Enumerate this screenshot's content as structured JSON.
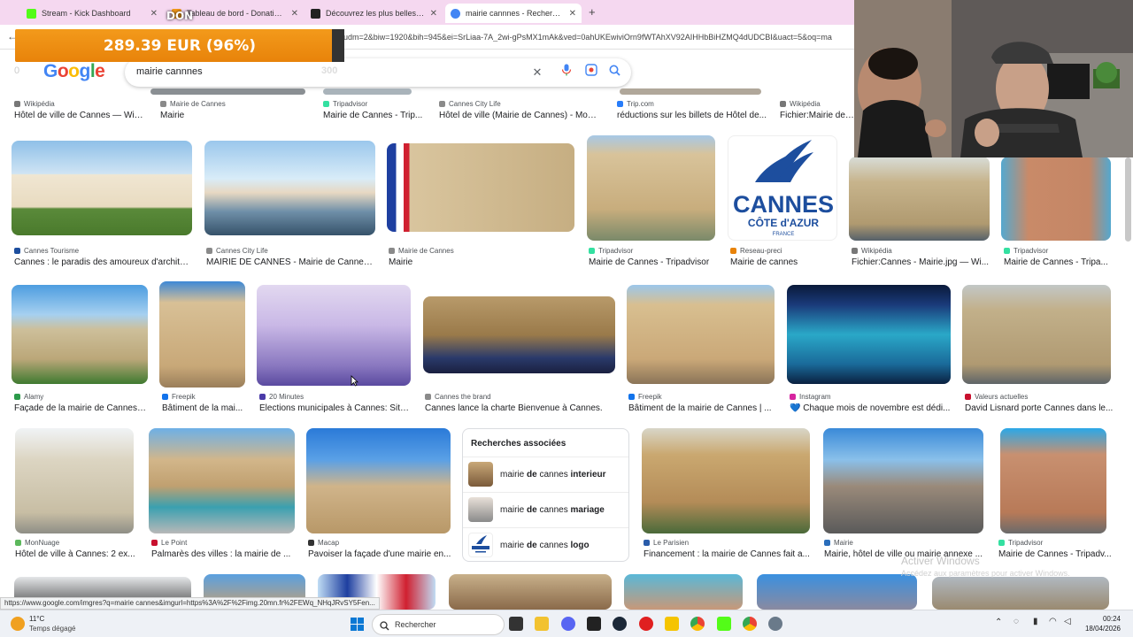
{
  "browser": {
    "tabs": [
      {
        "label": "Stream - Kick Dashboard",
        "color": "#53fc18"
      },
      {
        "label": "Tableau de bord - DonationAle",
        "color": "#f39a1b"
      },
      {
        "label": "Découvrez les plus belles mairi",
        "color": "#222222"
      },
      {
        "label": "mairie cannnes - Recherche Go",
        "color": "#4285f4"
      }
    ],
    "new_tab": "+",
    "url": "udm=2&biw=1920&bih=945&ei=SrLiaa-7A_2wi-gPsMX1mAk&ved=0ahUKEwiviOrn9fWTAhXV92AIHHbBiHZMQ4dUDCBI&uact=5&oq=ma"
  },
  "donation": {
    "amount": "289.39 EUR (96%)",
    "label": "DON"
  },
  "google": {
    "logo": "Google",
    "query": "mairie cannnes",
    "overlay_number": "300",
    "overlay_zero": "0"
  },
  "results": {
    "row0": [
      {
        "source": "Wikipédia",
        "caption": "Hôtel de ville de Cannes — Wiki...",
        "color": "#777777"
      },
      {
        "source": "Mairie de Cannes",
        "caption": "Mairie",
        "color": "#8a8a8a"
      },
      {
        "source": "Tripadvisor",
        "caption": "Mairie de Cannes - Trip...",
        "color": "#34e0a1"
      },
      {
        "source": "Cannes City Life",
        "caption": "Hôtel de ville (Mairie de Cannes) - Mon...",
        "color": "#8a8a8a"
      },
      {
        "source": "Trip.com",
        "caption": "réductions sur les billets de Hôtel de...",
        "color": "#287dfa"
      },
      {
        "source": "Wikipédia",
        "caption": "Fichier:Mairie de Ca",
        "color": "#777777"
      }
    ],
    "row1": [
      {
        "source": "Cannes Tourisme",
        "caption": "Cannes : le paradis des amoureux d'archite...",
        "color": "#1d4e9e"
      },
      {
        "source": "Cannes City Life",
        "caption": "MAIRIE DE CANNES - Mairie de Cannes ...",
        "color": "#8a8a8a"
      },
      {
        "source": "Mairie de Cannes",
        "caption": "Mairie",
        "color": "#8a8a8a"
      },
      {
        "source": "Tripadvisor",
        "caption": "Mairie de Cannes - Tripadvisor",
        "color": "#34e0a1"
      },
      {
        "source": "Reseau-preci",
        "caption": "Mairie de cannes",
        "color": "#e8830a"
      },
      {
        "source": "Wikipédia",
        "caption": "Fichier:Cannes - Mairie.jpg — Wi...",
        "color": "#777777"
      },
      {
        "source": "Tripadvisor",
        "caption": "Mairie de Cannes - Tripa...",
        "color": "#34e0a1"
      }
    ],
    "cannes_logo": {
      "word": "CANNES",
      "line2": "CÔTE d'AZUR",
      "line3": "FRANCE"
    },
    "row2": [
      {
        "source": "Alamy",
        "caption": "Façade de la mairie de Cannes,...",
        "color": "#2b9a4a"
      },
      {
        "source": "Freepik",
        "caption": "Bâtiment de la mai...",
        "color": "#1273eb"
      },
      {
        "source": "20 Minutes",
        "caption": "Élections municipales à Cannes: Situ...",
        "color": "#4a3aa8"
      },
      {
        "source": "Cannes the brand",
        "caption": "Cannes lance la charte Bienvenue à Cannes.",
        "color": "#8a8a8a"
      },
      {
        "source": "Freepik",
        "caption": "Bâtiment de la mairie de Cannes | ...",
        "color": "#1273eb"
      },
      {
        "source": "Instagram",
        "caption": "💙 Chaque mois de novembre est dédi...",
        "color": "#d6249f"
      },
      {
        "source": "Valeurs actuelles",
        "caption": "David Lisnard porte Cannes dans le...",
        "color": "#c8102e"
      }
    ],
    "row3": [
      {
        "source": "MonNuage",
        "caption": "Hôtel de ville à Cannes: 2 ex...",
        "color": "#5cb85c"
      },
      {
        "source": "Le Point",
        "caption": "Palmarès des villes : la mairie de ...",
        "color": "#c8102e"
      },
      {
        "source": "Macap",
        "caption": "Pavoiser la façade d'une mairie en...",
        "color": "#333333"
      },
      {
        "source": "Le Parisien",
        "caption": "Financement : la mairie de Cannes fait a...",
        "color": "#2a5caa"
      },
      {
        "source": "Mairie",
        "caption": "Mairie, hôtel de ville ou mairie annexe ...",
        "color": "#2a6ebb"
      },
      {
        "source": "Tripadvisor",
        "caption": "Mairie de Cannes - Tripadv...",
        "color": "#34e0a1"
      }
    ]
  },
  "related": {
    "title": "Recherches associées",
    "items": [
      {
        "prefix": "mairie ",
        "bold": "de",
        "mid": " cannes ",
        "bold2": "interieur"
      },
      {
        "prefix": "mairie ",
        "bold": "de",
        "mid": " cannes ",
        "bold2": "mariage"
      },
      {
        "prefix": "mairie ",
        "bold": "de",
        "mid": " cannes ",
        "bold2": "logo"
      }
    ]
  },
  "watermark": {
    "title": "Activer Windows",
    "subtitle": "Accédez aux paramètres pour activer Windows."
  },
  "status_url": "https://www.google.com/imgres?q=mairie cannes&imgurl=https%3A%2F%2Fimg.20mn.fr%2FEWq_NHqJRvSY5Fen...",
  "taskbar": {
    "temperature": "11°C",
    "weather": "Temps dégagé",
    "search_label": "Rechercher",
    "time": "00:24",
    "date": "18/04/2026"
  }
}
